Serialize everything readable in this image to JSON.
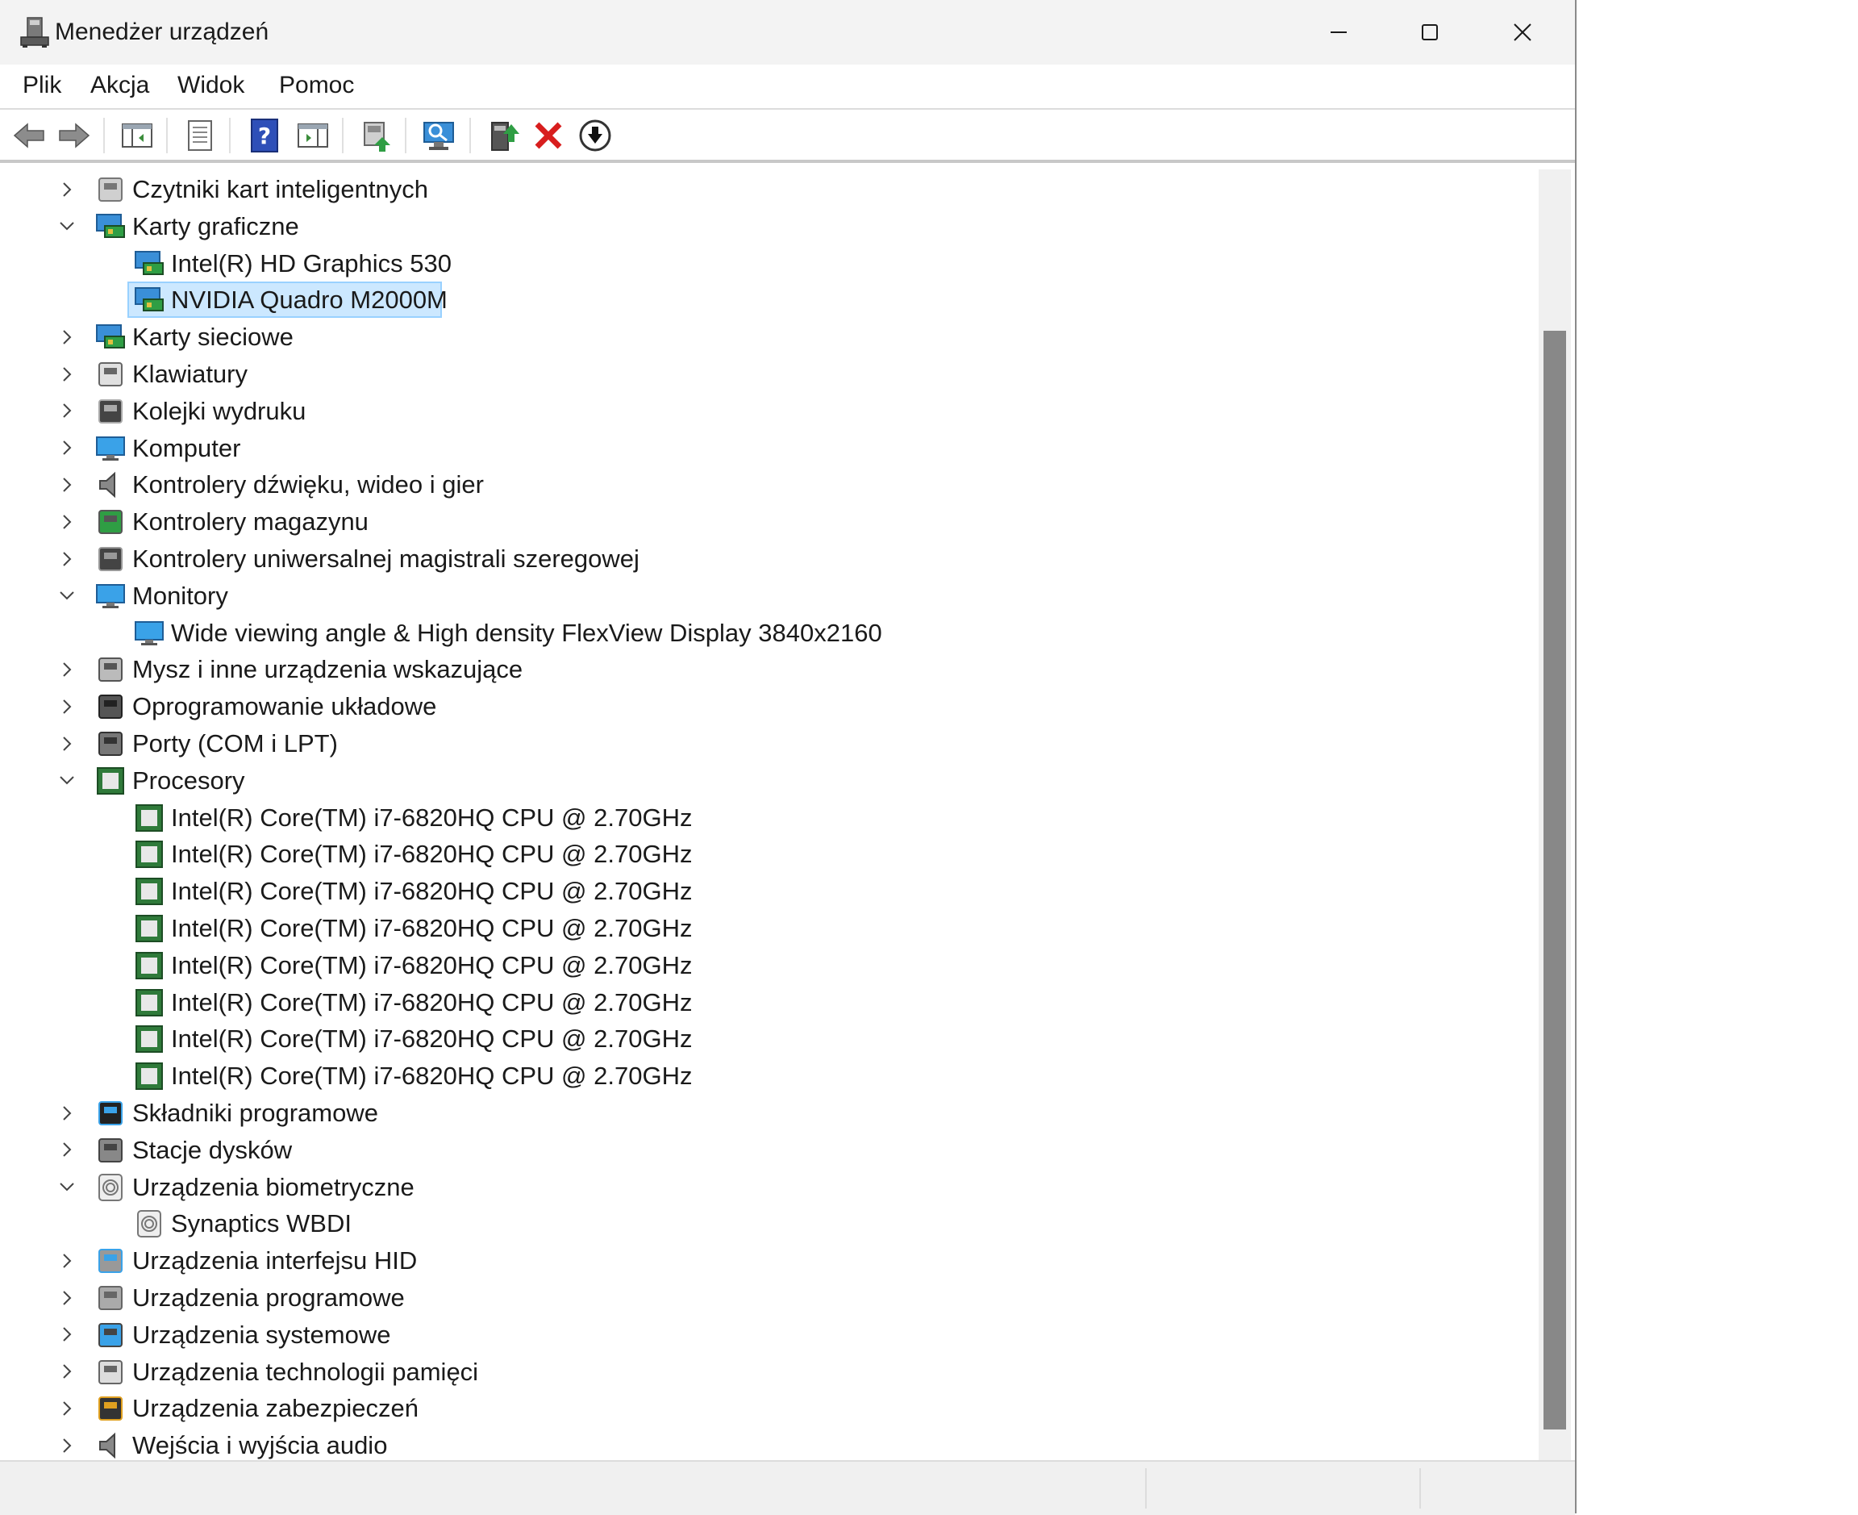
{
  "window": {
    "title": "Menedżer urządzeń"
  },
  "menu": [
    {
      "label": "Plik"
    },
    {
      "label": "Akcja"
    },
    {
      "label": "Widok"
    },
    {
      "label": "Pomoc"
    }
  ],
  "toolbar": {
    "buttons": [
      {
        "name": "back-button",
        "icon": "arrow-left-icon"
      },
      {
        "name": "forward-button",
        "icon": "arrow-right-icon"
      },
      {
        "name": "show-hide-console-tree-button",
        "icon": "console-tree-icon"
      },
      {
        "name": "properties-button",
        "icon": "properties-icon"
      },
      {
        "name": "help-button",
        "icon": "help-icon"
      },
      {
        "name": "show-hide-action-pane-button",
        "icon": "action-pane-icon"
      },
      {
        "name": "update-driver-button",
        "icon": "update-driver-icon"
      },
      {
        "name": "scan-hardware-button",
        "icon": "scan-hardware-icon"
      },
      {
        "name": "add-driver-button",
        "icon": "add-driver-icon"
      },
      {
        "name": "uninstall-device-button",
        "icon": "uninstall-icon"
      },
      {
        "name": "disable-device-button",
        "icon": "disable-icon"
      }
    ]
  },
  "tree": [
    {
      "label": "Czytniki kart inteligentnych",
      "level": 0,
      "state": "collapsed",
      "icon": "smart-card-reader-icon"
    },
    {
      "label": "Karty graficzne",
      "level": 0,
      "state": "expanded",
      "icon": "display-adapter-icon"
    },
    {
      "label": "Intel(R) HD Graphics 530",
      "level": 1,
      "state": "leaf",
      "icon": "display-adapter-icon"
    },
    {
      "label": "NVIDIA Quadro M2000M",
      "level": 1,
      "state": "leaf",
      "icon": "display-adapter-icon",
      "selected": true
    },
    {
      "label": "Karty sieciowe",
      "level": 0,
      "state": "collapsed",
      "icon": "network-adapter-icon"
    },
    {
      "label": "Klawiatury",
      "level": 0,
      "state": "collapsed",
      "icon": "keyboard-icon"
    },
    {
      "label": "Kolejki wydruku",
      "level": 0,
      "state": "collapsed",
      "icon": "printer-icon"
    },
    {
      "label": "Komputer",
      "level": 0,
      "state": "collapsed",
      "icon": "computer-icon"
    },
    {
      "label": "Kontrolery dźwięku, wideo i gier",
      "level": 0,
      "state": "collapsed",
      "icon": "speaker-icon"
    },
    {
      "label": "Kontrolery magazynu",
      "level": 0,
      "state": "collapsed",
      "icon": "storage-controller-icon"
    },
    {
      "label": "Kontrolery uniwersalnej magistrali szeregowej",
      "level": 0,
      "state": "collapsed",
      "icon": "usb-icon"
    },
    {
      "label": "Monitory",
      "level": 0,
      "state": "expanded",
      "icon": "monitor-icon"
    },
    {
      "label": "Wide viewing angle & High density FlexView Display 3840x2160",
      "level": 1,
      "state": "leaf",
      "icon": "monitor-icon"
    },
    {
      "label": "Mysz i inne urządzenia wskazujące",
      "level": 0,
      "state": "collapsed",
      "icon": "mouse-icon"
    },
    {
      "label": "Oprogramowanie układowe",
      "level": 0,
      "state": "collapsed",
      "icon": "firmware-icon"
    },
    {
      "label": "Porty (COM i LPT)",
      "level": 0,
      "state": "collapsed",
      "icon": "port-icon"
    },
    {
      "label": "Procesory",
      "level": 0,
      "state": "expanded",
      "icon": "processor-icon"
    },
    {
      "label": "Intel(R) Core(TM) i7-6820HQ CPU @ 2.70GHz",
      "level": 1,
      "state": "leaf",
      "icon": "processor-icon"
    },
    {
      "label": "Intel(R) Core(TM) i7-6820HQ CPU @ 2.70GHz",
      "level": 1,
      "state": "leaf",
      "icon": "processor-icon"
    },
    {
      "label": "Intel(R) Core(TM) i7-6820HQ CPU @ 2.70GHz",
      "level": 1,
      "state": "leaf",
      "icon": "processor-icon"
    },
    {
      "label": "Intel(R) Core(TM) i7-6820HQ CPU @ 2.70GHz",
      "level": 1,
      "state": "leaf",
      "icon": "processor-icon"
    },
    {
      "label": "Intel(R) Core(TM) i7-6820HQ CPU @ 2.70GHz",
      "level": 1,
      "state": "leaf",
      "icon": "processor-icon"
    },
    {
      "label": "Intel(R) Core(TM) i7-6820HQ CPU @ 2.70GHz",
      "level": 1,
      "state": "leaf",
      "icon": "processor-icon"
    },
    {
      "label": "Intel(R) Core(TM) i7-6820HQ CPU @ 2.70GHz",
      "level": 1,
      "state": "leaf",
      "icon": "processor-icon"
    },
    {
      "label": "Intel(R) Core(TM) i7-6820HQ CPU @ 2.70GHz",
      "level": 1,
      "state": "leaf",
      "icon": "processor-icon"
    },
    {
      "label": "Składniki programowe",
      "level": 0,
      "state": "collapsed",
      "icon": "software-component-icon"
    },
    {
      "label": "Stacje dysków",
      "level": 0,
      "state": "collapsed",
      "icon": "disk-drive-icon"
    },
    {
      "label": "Urządzenia biometryczne",
      "level": 0,
      "state": "expanded",
      "icon": "fingerprint-icon"
    },
    {
      "label": "Synaptics WBDI",
      "level": 1,
      "state": "leaf",
      "icon": "fingerprint-icon"
    },
    {
      "label": "Urządzenia interfejsu HID",
      "level": 0,
      "state": "collapsed",
      "icon": "hid-icon"
    },
    {
      "label": "Urządzenia programowe",
      "level": 0,
      "state": "collapsed",
      "icon": "software-device-icon"
    },
    {
      "label": "Urządzenia systemowe",
      "level": 0,
      "state": "collapsed",
      "icon": "system-device-icon"
    },
    {
      "label": "Urządzenia technologii pamięci",
      "level": 0,
      "state": "collapsed",
      "icon": "memory-technology-icon"
    },
    {
      "label": "Urządzenia zabezpieczeń",
      "level": 0,
      "state": "collapsed",
      "icon": "security-device-icon"
    },
    {
      "label": "Wejścia i wyjścia audio",
      "level": 0,
      "state": "collapsed",
      "icon": "audio-io-icon"
    }
  ]
}
